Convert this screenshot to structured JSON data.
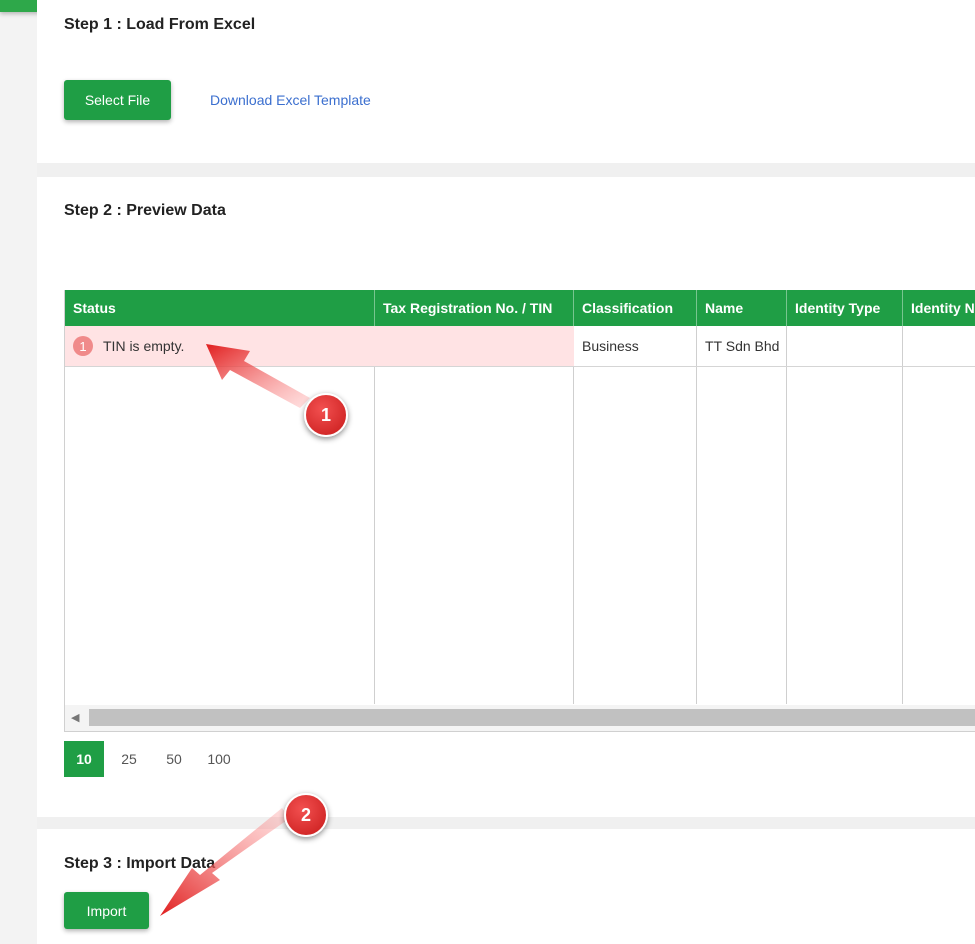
{
  "step1": {
    "title": "Step 1 : Load From Excel",
    "select_file_label": "Select File",
    "template_link": "Download Excel Template"
  },
  "step2": {
    "title": "Step 2 : Preview Data",
    "columns": [
      "Status",
      "Tax Registration No. / TIN",
      "Classification",
      "Name",
      "Identity Type",
      "Identity No"
    ],
    "rows": [
      {
        "status_badge": "1",
        "status": "TIN is empty.",
        "tin": "",
        "classification": "Business",
        "name": "TT Sdn Bhd",
        "identity_type": "",
        "identity_no": ""
      }
    ],
    "page_sizes": [
      "10",
      "25",
      "50",
      "100"
    ],
    "active_page_size": "10"
  },
  "step3": {
    "title": "Step 3 : Import Data",
    "import_label": "Import"
  },
  "annotations": [
    "1",
    "2"
  ],
  "colors": {
    "brand_green": "#1f9e45",
    "error_row": "#ffe3e4",
    "annotation_red": "#d92323",
    "link_blue": "#3b6fcf"
  }
}
